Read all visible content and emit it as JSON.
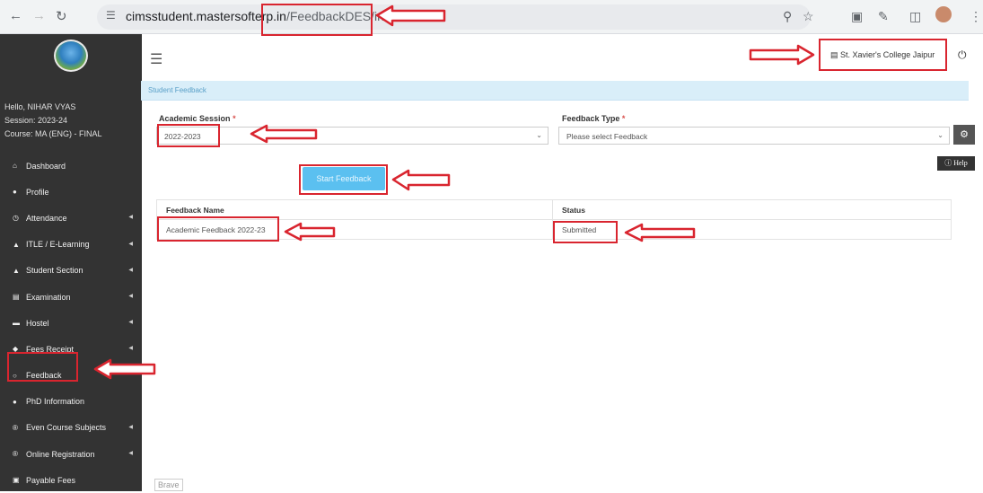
{
  "browser": {
    "url_host": "cimsstudent.mastersofterp.in",
    "url_path": "/FeedbackDES/index"
  },
  "sidebar": {
    "user": {
      "greeting": "Hello, NIHAR VYAS",
      "session": "Session: 2023-24",
      "course": "Course: MA (ENG) - FINAL"
    },
    "items": [
      {
        "label": "Dashboard",
        "icon": "dashboard-icon",
        "glyph": "⌂",
        "caret": false
      },
      {
        "label": "Profile",
        "icon": "profile-icon",
        "glyph": "●",
        "caret": false
      },
      {
        "label": "Attendance",
        "icon": "clock-icon",
        "glyph": "◷",
        "caret": true
      },
      {
        "label": "ITLE / E-Learning",
        "icon": "graduation-cap-icon",
        "glyph": "▲",
        "caret": true
      },
      {
        "label": "Student Section",
        "icon": "user-icon",
        "glyph": "▲",
        "caret": true
      },
      {
        "label": "Examination",
        "icon": "institution-icon",
        "glyph": "▤",
        "caret": true
      },
      {
        "label": "Hostel",
        "icon": "bed-icon",
        "glyph": "▬",
        "caret": true
      },
      {
        "label": "Fees Receipt",
        "icon": "gavel-icon",
        "glyph": "◆",
        "caret": true
      },
      {
        "label": "Feedback",
        "icon": "comment-icon",
        "glyph": "○",
        "caret": false
      },
      {
        "label": "PhD Information",
        "icon": "info-icon",
        "glyph": "●",
        "caret": false
      },
      {
        "label": "Even Course Subjects",
        "icon": "registered-icon",
        "glyph": "®",
        "caret": true
      },
      {
        "label": "Online Registration",
        "icon": "registered-icon",
        "glyph": "®",
        "caret": true
      },
      {
        "label": "Payable Fees",
        "icon": "money-icon",
        "glyph": "▣",
        "caret": false
      }
    ]
  },
  "topbar": {
    "college": "St. Xavier's College Jaipur"
  },
  "main": {
    "card_title": "Student Feedback",
    "academic_session_label": "Academic Session",
    "academic_session_value": "2022-2023",
    "feedback_type_label": "Feedback Type",
    "feedback_type_placeholder": "Please select Feedback",
    "start_button": "Start Feedback",
    "help_button": "Help",
    "table": {
      "headers": [
        "Feedback Name",
        "Status"
      ],
      "rows": [
        [
          "Academic Feedback 2022-23",
          "Submitted"
        ]
      ]
    }
  },
  "footer": {
    "brave_label": "Brave"
  },
  "colors": {
    "sidebar_bg": "#333333",
    "accent": "#5bc0f0",
    "annotation": "#d9252f"
  }
}
